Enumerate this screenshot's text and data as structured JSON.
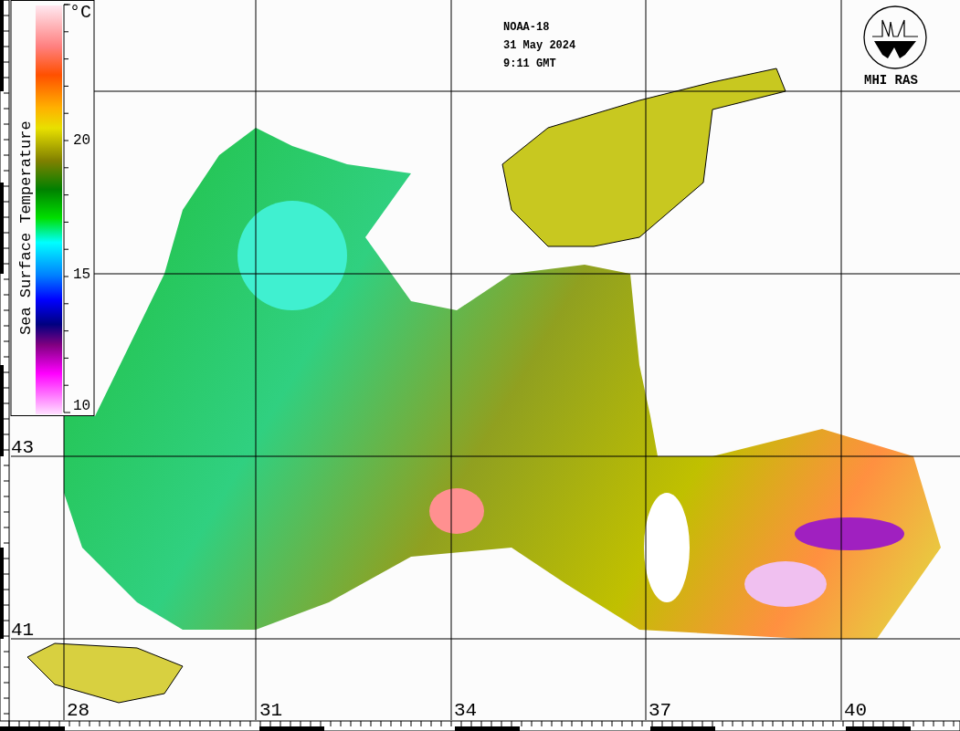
{
  "header": {
    "satellite": "NOAA-18",
    "date": "31 May 2024",
    "time": "9:11 GMT"
  },
  "logo": {
    "caption": "MHI RAS"
  },
  "legend": {
    "title": "Sea Surface Temperature",
    "unit": "°C",
    "ticks": [
      "20",
      "15",
      "10"
    ]
  },
  "latitude_labels": [
    "43",
    "41"
  ],
  "longitude_labels": [
    "28",
    "31",
    "34",
    "37",
    "40"
  ]
}
